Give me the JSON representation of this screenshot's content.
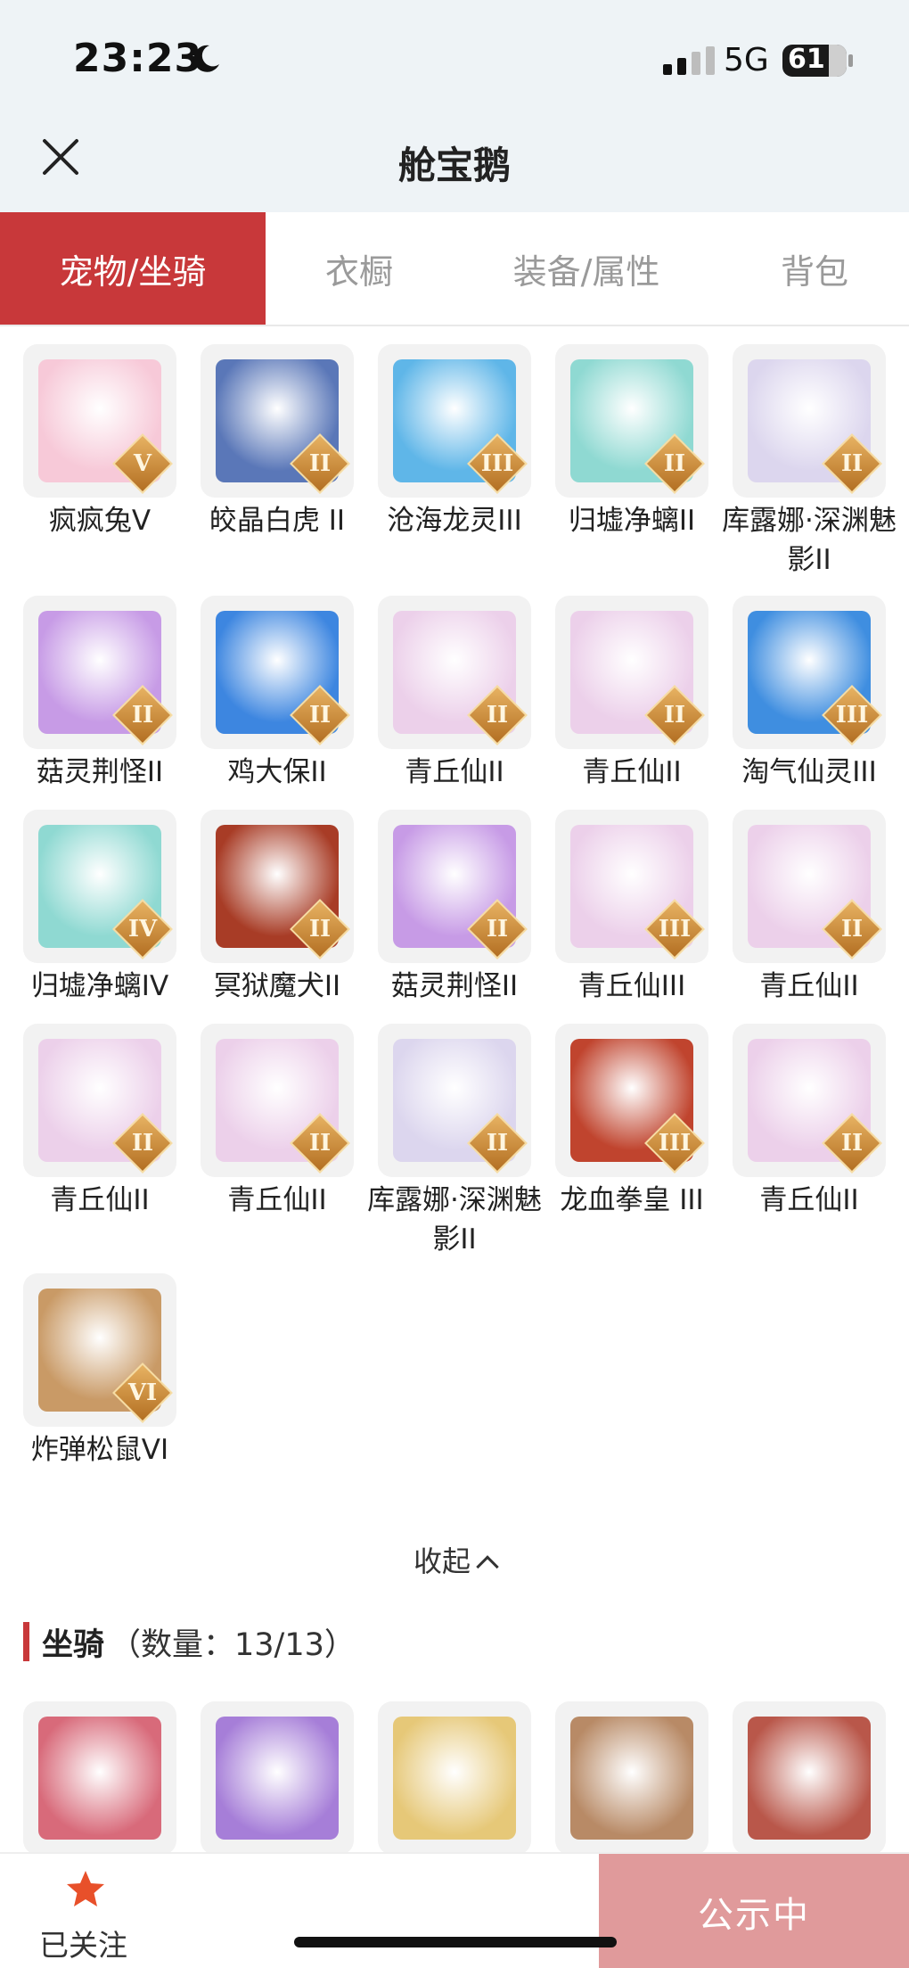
{
  "status_bar": {
    "time": "23:23",
    "network": "5G",
    "battery": "61"
  },
  "header": {
    "title": "舱宝鹅"
  },
  "tabs": [
    "宠物/坐骑",
    "衣橱",
    "装备/属性",
    "背包"
  ],
  "pets": [
    {
      "name": "疯疯兔Ⅴ",
      "rank": "V",
      "bg": "#f7c9d8"
    },
    {
      "name": "皎晶白虎 II",
      "rank": "II",
      "bg": "#5a77b8"
    },
    {
      "name": "沧海龙灵III",
      "rank": "III",
      "bg": "#5fb6e8"
    },
    {
      "name": "归墟净螭II",
      "rank": "II",
      "bg": "#8fd9d2"
    },
    {
      "name": "库露娜·深渊魅影II",
      "rank": "II",
      "bg": "#dcd6ee"
    },
    {
      "name": "菇灵荆怪II",
      "rank": "II",
      "bg": "#c79be6"
    },
    {
      "name": "鸡大保II",
      "rank": "II",
      "bg": "#3d86e0"
    },
    {
      "name": "青丘仙II",
      "rank": "II",
      "bg": "#ecd0ea"
    },
    {
      "name": "青丘仙II",
      "rank": "II",
      "bg": "#ecd0ea"
    },
    {
      "name": "淘气仙灵III",
      "rank": "III",
      "bg": "#3f8ee0"
    },
    {
      "name": "归墟净螭IV",
      "rank": "IV",
      "bg": "#8fd9d2"
    },
    {
      "name": "冥狱魔犬II",
      "rank": "II",
      "bg": "#a83c26"
    },
    {
      "name": "菇灵荆怪II",
      "rank": "II",
      "bg": "#c79be6"
    },
    {
      "name": "青丘仙III",
      "rank": "III",
      "bg": "#ecd0ea"
    },
    {
      "name": "青丘仙II",
      "rank": "II",
      "bg": "#ecd0ea"
    },
    {
      "name": "青丘仙II",
      "rank": "II",
      "bg": "#ecd0ea"
    },
    {
      "name": "青丘仙II",
      "rank": "II",
      "bg": "#ecd0ea"
    },
    {
      "name": "库露娜·深渊魅影II",
      "rank": "II",
      "bg": "#dcd6ee"
    },
    {
      "name": "龙血拳皇 III",
      "rank": "III",
      "bg": "#c0442e"
    },
    {
      "name": "青丘仙II",
      "rank": "II",
      "bg": "#ecd0ea"
    },
    {
      "name": "炸弹松鼠VI",
      "rank": "VI",
      "bg": "#c99a66"
    }
  ],
  "collapse_label": "收起",
  "mount_section": {
    "title": "坐骑",
    "count": "（数量：13/13）"
  },
  "mounts": [
    {
      "bg": "#d86a7a"
    },
    {
      "bg": "#a67ed8"
    },
    {
      "bg": "#e6c878"
    },
    {
      "bg": "#b88a66"
    },
    {
      "bg": "#b9574a"
    }
  ],
  "bottom_bar": {
    "follow_label": "已关注",
    "status_label": "公示中"
  },
  "colors": {
    "accent": "#c8383a",
    "status_button": "#e09a9b",
    "star": "#e8502a"
  }
}
